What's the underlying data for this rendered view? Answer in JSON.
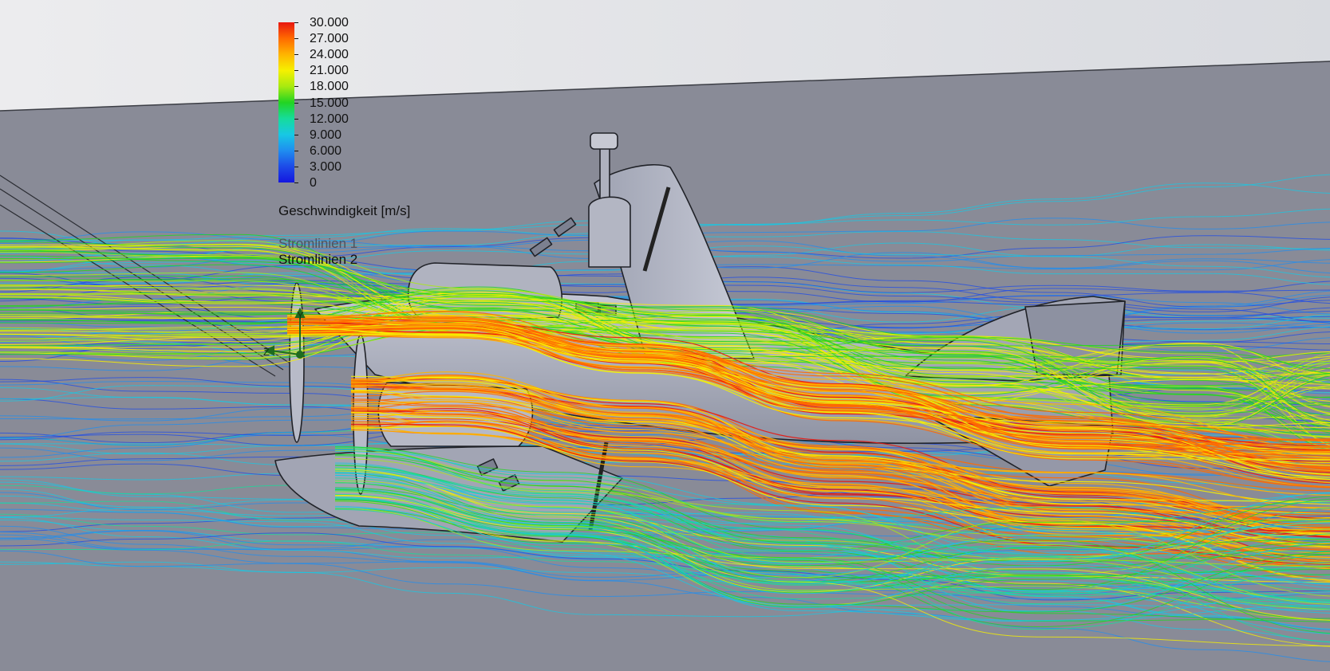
{
  "legend": {
    "ticks": [
      "30.000",
      "27.000",
      "24.000",
      "21.000",
      "18.000",
      "15.000",
      "12.000",
      "9.000",
      "6.000",
      "3.000",
      "0"
    ],
    "quantity_label": "Geschwindigkeit [m/s]",
    "series": [
      {
        "label": "Stromlinien 1",
        "active": false
      },
      {
        "label": "Stromlinien 2",
        "active": true
      }
    ]
  },
  "triad": {
    "axis_y": "Y",
    "axis_z": "Z"
  },
  "colors": {
    "background": "#8a8c98",
    "sky": "#e6e7ea",
    "model_surface": "#a9acbb",
    "scale": [
      "#e8160f",
      "#ff6a00",
      "#ffb400",
      "#f6f000",
      "#a8ea10",
      "#22d422",
      "#16dc9a",
      "#17c8e4",
      "#1f8ef0",
      "#1d4be8",
      "#1416e0"
    ]
  }
}
